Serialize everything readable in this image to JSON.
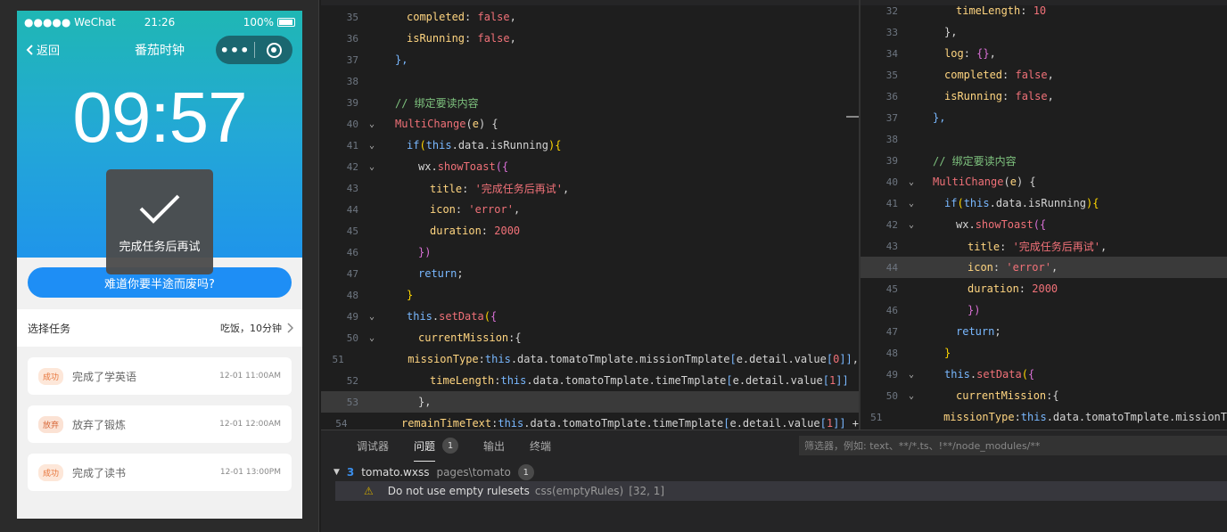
{
  "simulator": {
    "status": {
      "carrier": "●●●●● WeChat",
      "time": "21:26",
      "battery": "100%"
    },
    "nav": {
      "back_label": "返回",
      "title": "番茄时钟"
    },
    "timer": "09:57",
    "toast": {
      "title": "完成任务后再试"
    },
    "quit_button": "难道你要半途而废吗?",
    "task_select": {
      "label": "选择任务",
      "value": "吃饭，10分钟"
    },
    "logs": [
      {
        "status": "成功",
        "text": "完成了学英语",
        "time": "12-01 11:00AM"
      },
      {
        "status": "放弃",
        "text": "放弃了锻炼",
        "time": "12-01 12:00AM"
      },
      {
        "status": "成功",
        "text": "完成了读书",
        "time": "12-01 13:00PM"
      }
    ]
  },
  "editor_left": {
    "lines": [
      {
        "n": "35",
        "fold": "",
        "indent": 1,
        "tokens": [
          [
            "p",
            "completed"
          ],
          [
            "w",
            ": "
          ],
          [
            "k",
            "false"
          ],
          [
            "w",
            ","
          ]
        ]
      },
      {
        "n": "36",
        "fold": "",
        "indent": 1,
        "tokens": [
          [
            "p",
            "isRunning"
          ],
          [
            "w",
            ": "
          ],
          [
            "k",
            "false"
          ],
          [
            "w",
            ","
          ]
        ]
      },
      {
        "n": "37",
        "fold": "",
        "indent": 0,
        "tokens": [
          [
            "b",
            "},"
          ]
        ]
      },
      {
        "n": "38",
        "fold": "",
        "indent": 0,
        "tokens": []
      },
      {
        "n": "39",
        "fold": "",
        "indent": 0,
        "tokens": [
          [
            "c",
            "// 绑定要读内容"
          ]
        ]
      },
      {
        "n": "40",
        "fold": "v",
        "indent": 0,
        "tokens": [
          [
            "f",
            "MultiChange"
          ],
          [
            "w",
            "("
          ],
          [
            "p",
            "e"
          ],
          [
            "w",
            ") {"
          ]
        ]
      },
      {
        "n": "41",
        "fold": "v",
        "indent": 1,
        "tokens": [
          [
            "k2",
            "if"
          ],
          [
            "y",
            "("
          ],
          [
            "k2",
            "this"
          ],
          [
            "w",
            ".data.isRunning"
          ],
          [
            "y",
            "){"
          ]
        ]
      },
      {
        "n": "42",
        "fold": "v",
        "indent": 2,
        "tokens": [
          [
            "w",
            "wx."
          ],
          [
            "f",
            "showToast"
          ],
          [
            "m",
            "({"
          ]
        ]
      },
      {
        "n": "43",
        "fold": "",
        "indent": 3,
        "tokens": [
          [
            "p",
            "title"
          ],
          [
            "w",
            ": "
          ],
          [
            "s",
            "'完成任务后再试'"
          ],
          [
            "w",
            ","
          ]
        ]
      },
      {
        "n": "44",
        "fold": "",
        "indent": 3,
        "tokens": [
          [
            "p",
            "icon"
          ],
          [
            "w",
            ": "
          ],
          [
            "s",
            "'error'"
          ],
          [
            "w",
            ","
          ]
        ]
      },
      {
        "n": "45",
        "fold": "",
        "indent": 3,
        "tokens": [
          [
            "p",
            "duration"
          ],
          [
            "w",
            ": "
          ],
          [
            "k",
            "2000"
          ]
        ]
      },
      {
        "n": "46",
        "fold": "",
        "indent": 2,
        "tokens": [
          [
            "m",
            "})"
          ]
        ]
      },
      {
        "n": "47",
        "fold": "",
        "indent": 2,
        "tokens": [
          [
            "k2",
            "return"
          ],
          [
            "w",
            ";"
          ]
        ]
      },
      {
        "n": "48",
        "fold": "",
        "indent": 1,
        "tokens": [
          [
            "y",
            "}"
          ]
        ]
      },
      {
        "n": "49",
        "fold": "v",
        "indent": 1,
        "tokens": [
          [
            "k2",
            "this"
          ],
          [
            "w",
            "."
          ],
          [
            "f",
            "setData"
          ],
          [
            "y",
            "("
          ],
          [
            "m",
            "{"
          ]
        ]
      },
      {
        "n": "50",
        "fold": "v",
        "indent": 2,
        "tokens": [
          [
            "p",
            "currentMission"
          ],
          [
            "w",
            ":{"
          ]
        ]
      },
      {
        "n": "51",
        "fold": "",
        "indent": 3,
        "tokens": [
          [
            "p",
            "missionType"
          ],
          [
            "w",
            ":"
          ],
          [
            "k2",
            "this"
          ],
          [
            "w",
            ".data.tomatoTmplate.missionTmplate"
          ],
          [
            "b",
            "["
          ],
          [
            "w",
            "e.detail.value"
          ],
          [
            "b",
            "["
          ],
          [
            "k",
            "0"
          ],
          [
            "b",
            "]]"
          ],
          [
            "w",
            ","
          ]
        ]
      },
      {
        "n": "52",
        "fold": "",
        "indent": 3,
        "tokens": [
          [
            "p",
            "timeLength"
          ],
          [
            "w",
            ":"
          ],
          [
            "k2",
            "this"
          ],
          [
            "w",
            ".data.tomatoTmplate.timeTmplate"
          ],
          [
            "b",
            "["
          ],
          [
            "w",
            "e.detail.value"
          ],
          [
            "b",
            "["
          ],
          [
            "k",
            "1"
          ],
          [
            "b",
            "]]"
          ]
        ]
      },
      {
        "n": "53",
        "fold": "",
        "indent": 2,
        "tokens": [
          [
            "w",
            "},"
          ]
        ],
        "hl": true
      },
      {
        "n": "54",
        "fold": "",
        "indent": 2,
        "tokens": [
          [
            "p",
            "remainTimeText"
          ],
          [
            "w",
            ":"
          ],
          [
            "k2",
            "this"
          ],
          [
            "w",
            ".data.tomatoTmplate.timeTmplate"
          ],
          [
            "b",
            "["
          ],
          [
            "w",
            "e.detail.value"
          ],
          [
            "b",
            "["
          ],
          [
            "k",
            "1"
          ],
          [
            "b",
            "]]"
          ],
          [
            "w",
            " +"
          ]
        ]
      }
    ]
  },
  "editor_right": {
    "lines": [
      {
        "n": "32",
        "fold": "",
        "indent": 2,
        "tokens": [
          [
            "p",
            "timeLength"
          ],
          [
            "w",
            ": "
          ],
          [
            "k",
            "10"
          ]
        ]
      },
      {
        "n": "33",
        "fold": "",
        "indent": 1,
        "tokens": [
          [
            "w",
            "},"
          ]
        ]
      },
      {
        "n": "34",
        "fold": "",
        "indent": 1,
        "tokens": [
          [
            "p",
            "log"
          ],
          [
            "w",
            ": "
          ],
          [
            "m",
            "{}"
          ],
          [
            "w",
            ","
          ]
        ]
      },
      {
        "n": "35",
        "fold": "",
        "indent": 1,
        "tokens": [
          [
            "p",
            "completed"
          ],
          [
            "w",
            ": "
          ],
          [
            "k",
            "false"
          ],
          [
            "w",
            ","
          ]
        ]
      },
      {
        "n": "36",
        "fold": "",
        "indent": 1,
        "tokens": [
          [
            "p",
            "isRunning"
          ],
          [
            "w",
            ": "
          ],
          [
            "k",
            "false"
          ],
          [
            "w",
            ","
          ]
        ]
      },
      {
        "n": "37",
        "fold": "",
        "indent": 0,
        "tokens": [
          [
            "b",
            "},"
          ]
        ]
      },
      {
        "n": "38",
        "fold": "",
        "indent": 0,
        "tokens": []
      },
      {
        "n": "39",
        "fold": "",
        "indent": 0,
        "tokens": [
          [
            "c",
            "// 绑定要读内容"
          ]
        ]
      },
      {
        "n": "40",
        "fold": "v",
        "indent": 0,
        "tokens": [
          [
            "f",
            "MultiChange"
          ],
          [
            "w",
            "("
          ],
          [
            "p",
            "e"
          ],
          [
            "w",
            ") {"
          ]
        ]
      },
      {
        "n": "41",
        "fold": "v",
        "indent": 1,
        "tokens": [
          [
            "k2",
            "if"
          ],
          [
            "y",
            "("
          ],
          [
            "k2",
            "this"
          ],
          [
            "w",
            ".data.isRunning"
          ],
          [
            "y",
            "){"
          ]
        ]
      },
      {
        "n": "42",
        "fold": "v",
        "indent": 2,
        "tokens": [
          [
            "w",
            "wx."
          ],
          [
            "f",
            "showToast"
          ],
          [
            "m",
            "({"
          ]
        ]
      },
      {
        "n": "43",
        "fold": "",
        "indent": 3,
        "tokens": [
          [
            "p",
            "title"
          ],
          [
            "w",
            ": "
          ],
          [
            "s",
            "'完成任务后再试'"
          ],
          [
            "w",
            ","
          ]
        ]
      },
      {
        "n": "44",
        "fold": "",
        "indent": 3,
        "tokens": [
          [
            "p",
            "icon"
          ],
          [
            "w",
            ": "
          ],
          [
            "s",
            "'error'"
          ],
          [
            "w",
            ","
          ]
        ],
        "hl": true
      },
      {
        "n": "45",
        "fold": "",
        "indent": 3,
        "tokens": [
          [
            "p",
            "duration"
          ],
          [
            "w",
            ": "
          ],
          [
            "k",
            "2000"
          ]
        ]
      },
      {
        "n": "46",
        "fold": "",
        "indent": 3,
        "tokens": [
          [
            "m",
            "})"
          ]
        ]
      },
      {
        "n": "47",
        "fold": "",
        "indent": 2,
        "tokens": [
          [
            "k2",
            "return"
          ],
          [
            "w",
            ";"
          ]
        ]
      },
      {
        "n": "48",
        "fold": "",
        "indent": 1,
        "tokens": [
          [
            "y",
            "}"
          ]
        ]
      },
      {
        "n": "49",
        "fold": "v",
        "indent": 1,
        "tokens": [
          [
            "k2",
            "this"
          ],
          [
            "w",
            "."
          ],
          [
            "f",
            "setData"
          ],
          [
            "y",
            "("
          ],
          [
            "m",
            "{"
          ]
        ]
      },
      {
        "n": "50",
        "fold": "v",
        "indent": 2,
        "tokens": [
          [
            "p",
            "currentMission"
          ],
          [
            "w",
            ":{"
          ]
        ]
      },
      {
        "n": "51",
        "fold": "",
        "indent": 3,
        "tokens": [
          [
            "p",
            "missionType"
          ],
          [
            "w",
            ":"
          ],
          [
            "k2",
            "this"
          ],
          [
            "w",
            ".data.tomatoTmplate.missionT"
          ]
        ]
      }
    ]
  },
  "panel": {
    "tabs": [
      {
        "label": "调试器"
      },
      {
        "label": "问题",
        "badge": "1",
        "active": true
      },
      {
        "label": "输出"
      },
      {
        "label": "终端"
      }
    ],
    "filter_placeholder": "筛选器，例如: text、**/*.ts、!**/node_modules/**",
    "file": {
      "name": "tomato.wxss",
      "path": "pages\\tomato",
      "count": "1"
    },
    "problem": {
      "message": "Do not use empty rulesets",
      "source": "css(emptyRules)",
      "position": "[32, 1]"
    }
  },
  "colors": {
    "keyword_value": "#f07178",
    "property": "#ffd580",
    "string": "#f07178",
    "comment": "#7ec27e",
    "function": "#f07178",
    "keyword": "#79b8ff"
  }
}
